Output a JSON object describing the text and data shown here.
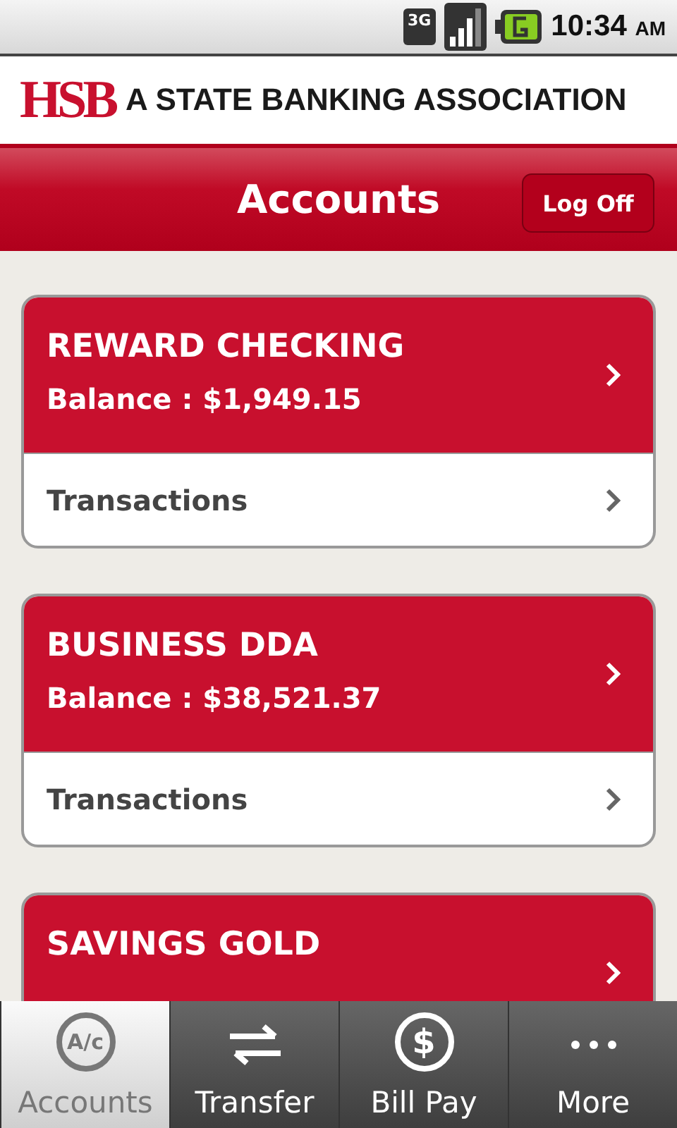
{
  "status_bar": {
    "network": "3G",
    "time": "10:34",
    "ampm": "AM"
  },
  "brand": {
    "logo": "HSB",
    "tagline": "A STATE BANKING ASSOCIATION"
  },
  "title_bar": {
    "title": "Accounts",
    "button": "Log Off"
  },
  "accounts": [
    {
      "name": "REWARD CHECKING",
      "balance": "Balance : $1,949.15",
      "link": "Transactions"
    },
    {
      "name": "BUSINESS DDA",
      "balance": "Balance : $38,521.37",
      "link": "Transactions"
    },
    {
      "name": "SAVINGS GOLD"
    }
  ],
  "tabs": [
    {
      "label": "Accounts",
      "kind": "circle",
      "icon_text": "A/c",
      "selected": true
    },
    {
      "label": "Transfer",
      "kind": "arrows",
      "selected": false
    },
    {
      "label": "Bill Pay",
      "kind": "coin",
      "icon_text": "$",
      "selected": false
    },
    {
      "label": "More",
      "kind": "dots",
      "selected": false
    }
  ]
}
